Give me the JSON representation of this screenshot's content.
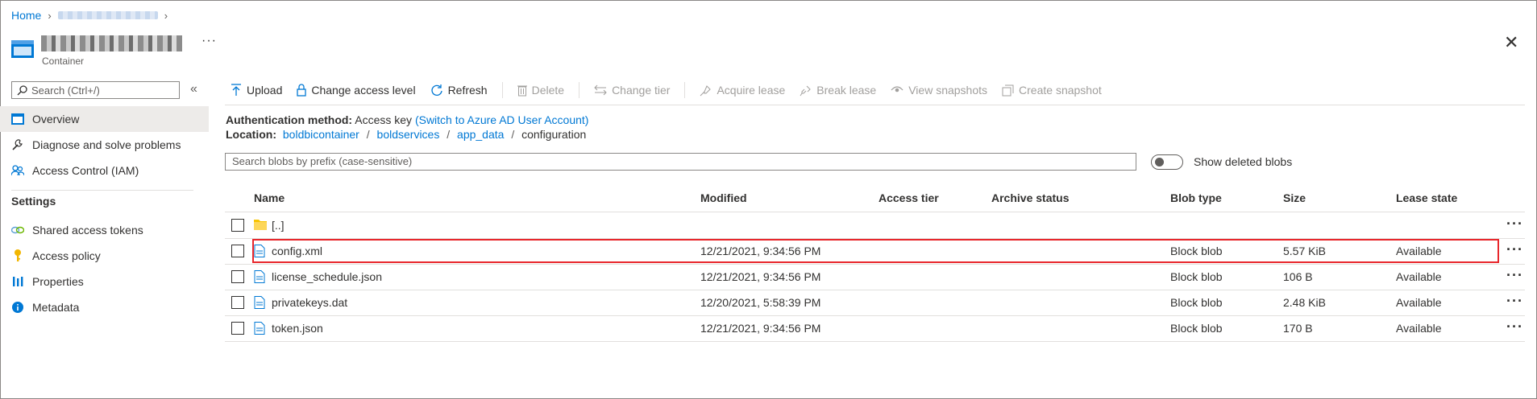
{
  "breadcrumb": {
    "home": "Home"
  },
  "header": {
    "subtitle": "Container",
    "more": "···",
    "close": "✕"
  },
  "sidebar": {
    "search_placeholder": "Search (Ctrl+/)",
    "collapse": "«",
    "items_top": [
      {
        "label": "Overview",
        "icon": "overview-icon"
      },
      {
        "label": "Diagnose and solve problems",
        "icon": "wrench-icon"
      },
      {
        "label": "Access Control (IAM)",
        "icon": "people-icon"
      }
    ],
    "settings_heading": "Settings",
    "items_settings": [
      {
        "label": "Shared access tokens",
        "icon": "link-icon"
      },
      {
        "label": "Access policy",
        "icon": "key-icon"
      },
      {
        "label": "Properties",
        "icon": "properties-icon"
      },
      {
        "label": "Metadata",
        "icon": "info-icon"
      }
    ]
  },
  "toolbar": {
    "upload": "Upload",
    "change_access_level": "Change access level",
    "refresh": "Refresh",
    "delete": "Delete",
    "change_tier": "Change tier",
    "acquire_lease": "Acquire lease",
    "break_lease": "Break lease",
    "view_snapshots": "View snapshots",
    "create_snapshot": "Create snapshot"
  },
  "auth": {
    "label": "Authentication method:",
    "value": "Access key",
    "link": "(Switch to Azure AD User Account)"
  },
  "location": {
    "label": "Location:",
    "path": [
      "boldbicontainer",
      "boldservices",
      "app_data"
    ],
    "current": "configuration",
    "sep": "/"
  },
  "filter": {
    "placeholder": "Search blobs by prefix (case-sensitive)",
    "toggle_label": "Show deleted blobs"
  },
  "table": {
    "headers": {
      "name": "Name",
      "modified": "Modified",
      "access_tier": "Access tier",
      "archive_status": "Archive status",
      "blob_type": "Blob type",
      "size": "Size",
      "lease_state": "Lease state"
    },
    "rows": [
      {
        "name": "[..]",
        "type": "folder",
        "modified": "",
        "blob_type": "",
        "size": "",
        "lease_state": ""
      },
      {
        "name": "config.xml",
        "type": "file",
        "modified": "12/21/2021, 9:34:56 PM",
        "blob_type": "Block blob",
        "size": "5.57 KiB",
        "lease_state": "Available"
      },
      {
        "name": "license_schedule.json",
        "type": "file",
        "modified": "12/21/2021, 9:34:56 PM",
        "blob_type": "Block blob",
        "size": "106 B",
        "lease_state": "Available"
      },
      {
        "name": "privatekeys.dat",
        "type": "file",
        "modified": "12/20/2021, 5:58:39 PM",
        "blob_type": "Block blob",
        "size": "2.48 KiB",
        "lease_state": "Available"
      },
      {
        "name": "token.json",
        "type": "file",
        "modified": "12/21/2021, 9:34:56 PM",
        "blob_type": "Block blob",
        "size": "170 B",
        "lease_state": "Available"
      }
    ],
    "row_more": "···"
  },
  "colors": {
    "accent": "#0078d4",
    "highlight": "#e8262b",
    "folder": "#f8c400"
  }
}
